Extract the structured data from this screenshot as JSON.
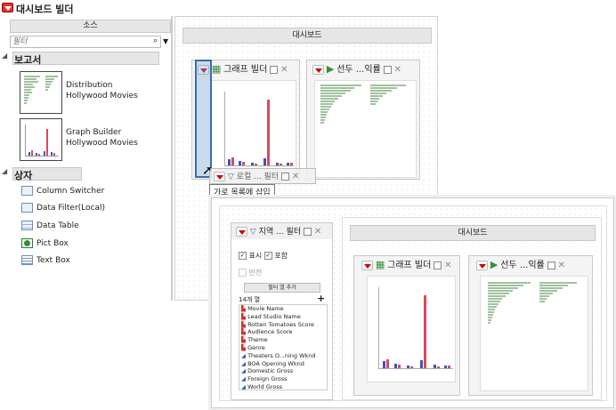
{
  "app": {
    "title": "대시보드 빌더"
  },
  "sources": {
    "header": "소스",
    "filter_placeholder": "필터",
    "reports_label": "보고서",
    "reports": [
      {
        "name": "Distribution Hollywood Movies",
        "line1": "Distribution",
        "line2": "Hollywood Movies"
      },
      {
        "name": "Graph Builder Hollywood Movies",
        "line1": "Graph Builder",
        "line2": "Hollywood Movies"
      }
    ],
    "boxes_label": "상자",
    "boxes": [
      {
        "label": "Column Switcher",
        "icon": "column-switcher-icon"
      },
      {
        "label": "Data Filter(Local)",
        "icon": "data-filter-icon"
      },
      {
        "label": "Data Table",
        "icon": "data-table-icon"
      },
      {
        "label": "Pict Box",
        "icon": "tree-picture-icon"
      },
      {
        "label": "Text Box",
        "icon": "text-box-icon"
      }
    ]
  },
  "canvas": {
    "header": "대시보드",
    "graph_title": "그래프 빌더",
    "rank_title": "선두 ...익률",
    "drag_title": "로컬 ... 필터",
    "tooltip": "가로 목록에 삽입"
  },
  "preview": {
    "filter_title": "지역 ... 필터",
    "show_label": "표시",
    "include_label": "포함",
    "invert_label": "반전",
    "add_column_button": "필터 열 추가",
    "column_count": "14개 열",
    "columns": [
      {
        "name": "Movie Name",
        "type": "nominal"
      },
      {
        "name": "Lead Studio Name",
        "type": "nominal"
      },
      {
        "name": "Rotten Tomatoes Score",
        "type": "nominal"
      },
      {
        "name": "Audience Score",
        "type": "nominal"
      },
      {
        "name": "Theme",
        "type": "nominal"
      },
      {
        "name": "Genre",
        "type": "nominal"
      },
      {
        "name": "Theaters O...ning Wknd",
        "type": "continuous"
      },
      {
        "name": "BOA Opening Wknd",
        "type": "continuous"
      },
      {
        "name": "Domestic Gross",
        "type": "continuous"
      },
      {
        "name": "Foreign Gross",
        "type": "continuous"
      },
      {
        "name": "World Gross",
        "type": "continuous"
      }
    ],
    "dashboard_header": "대시보드",
    "graph_title": "그래프 빌더",
    "rank_title": "선두 ...익률"
  },
  "colors": {
    "accent": "#3a6ea5",
    "red_bar": "#d84b5a",
    "blue_bar": "#3d53c4",
    "green_bar": "#9fc29f"
  }
}
